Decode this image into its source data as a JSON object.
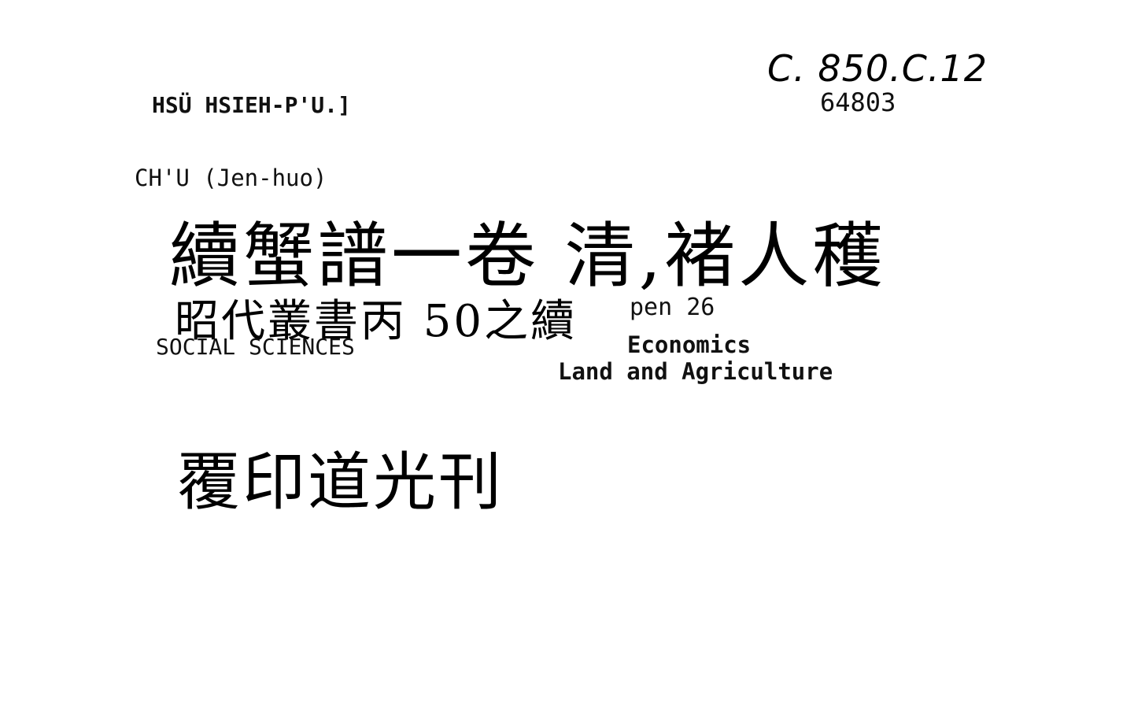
{
  "card": {
    "call_number": "C. 850.C.12",
    "accession_number": "64803",
    "heading_name": "HSÜ HSIEH-P'U.]",
    "author": "CH'U (Jen-huo)",
    "title_chinese": "續蟹譜一卷 清,褚人穫",
    "edition_chinese": "昭代叢書丙 50之續",
    "collection_ref": "pen 26",
    "subject_main": "SOCIAL SCIENCES",
    "subject_sub1": "Economics",
    "subject_sub2": "Land and Agriculture",
    "publisher_chinese": "覆印道光刊"
  }
}
